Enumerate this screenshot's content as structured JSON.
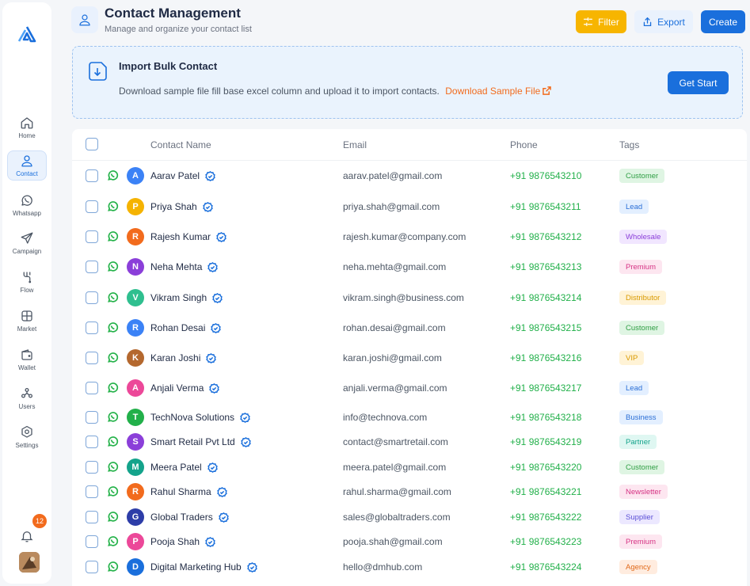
{
  "sidebar": {
    "items": [
      {
        "label": "Home",
        "icon": "home-icon",
        "active": false
      },
      {
        "label": "Contact",
        "icon": "user-icon",
        "active": true
      },
      {
        "label": "Whatsapp",
        "icon": "whatsapp-icon",
        "active": false
      },
      {
        "label": "Campaign",
        "icon": "send-icon",
        "active": false
      },
      {
        "label": "Flow",
        "icon": "flow-icon",
        "active": false
      },
      {
        "label": "Market",
        "icon": "market-icon",
        "active": false
      },
      {
        "label": "Wallet",
        "icon": "wallet-icon",
        "active": false
      },
      {
        "label": "Users",
        "icon": "users-icon",
        "active": false
      },
      {
        "label": "Settings",
        "icon": "settings-icon",
        "active": false
      }
    ],
    "notification_count": "12"
  },
  "header": {
    "title": "Contact Management",
    "subtitle": "Manage and organize your contact list",
    "filter_label": "Filter",
    "export_label": "Export",
    "create_label": "Create"
  },
  "banner": {
    "title": "Import Bulk Contact",
    "text": "Download sample file fill base excel column and upload it to import contacts.",
    "link": "Download Sample File",
    "button": "Get Start"
  },
  "table": {
    "columns": {
      "name": "Contact Name",
      "email": "Email",
      "phone": "Phone",
      "tags": "Tags"
    },
    "rows": [
      {
        "initial": "A",
        "name": "Aarav Patel",
        "email": "aarav.patel@gmail.com",
        "phone": "+91 9876543210",
        "tag": "Customer",
        "avatar_color": "#3b82f6",
        "tag_bg": "#dff5e3",
        "tag_fg": "#2f9e44"
      },
      {
        "initial": "P",
        "name": "Priya Shah",
        "email": "priya.shah@gmail.com",
        "phone": "+91 9876543211",
        "tag": "Lead",
        "avatar_color": "#f5b301",
        "tag_bg": "#e3efff",
        "tag_fg": "#2b6fd6"
      },
      {
        "initial": "R",
        "name": "Rajesh Kumar",
        "email": "rajesh.kumar@company.com",
        "phone": "+91 9876543212",
        "tag": "Wholesale",
        "avatar_color": "#f26b1d",
        "tag_bg": "#f1e6ff",
        "tag_fg": "#8b3fd9"
      },
      {
        "initial": "N",
        "name": "Neha Mehta",
        "email": "neha.mehta@gmail.com",
        "phone": "+91 9876543213",
        "tag": "Premium",
        "avatar_color": "#8b3fd9",
        "tag_bg": "#fde6f0",
        "tag_fg": "#d63384"
      },
      {
        "initial": "V",
        "name": "Vikram Singh",
        "email": "vikram.singh@business.com",
        "phone": "+91 9876543214",
        "tag": "Distributor",
        "avatar_color": "#2fbf8f",
        "tag_bg": "#fff3d6",
        "tag_fg": "#d99a00"
      },
      {
        "initial": "R",
        "name": "Rohan Desai",
        "email": "rohan.desai@gmail.com",
        "phone": "+91 9876543215",
        "tag": "Customer",
        "avatar_color": "#3b82f6",
        "tag_bg": "#dff5e3",
        "tag_fg": "#2f9e44"
      },
      {
        "initial": "K",
        "name": "Karan Joshi",
        "email": "karan.joshi@gmail.com",
        "phone": "+91 9876543216",
        "tag": "VIP",
        "avatar_color": "#b4682e",
        "tag_bg": "#fff3d6",
        "tag_fg": "#d99a00"
      },
      {
        "initial": "A",
        "name": "Anjali Verma",
        "email": "anjali.verma@gmail.com",
        "phone": "+91 9876543217",
        "tag": "Lead",
        "avatar_color": "#ec4899",
        "tag_bg": "#e3efff",
        "tag_fg": "#2b6fd6"
      },
      {
        "initial": "T",
        "name": "TechNova Solutions",
        "email": "info@technova.com",
        "phone": "+91 9876543218",
        "tag": "Business",
        "avatar_color": "#22b04a",
        "tag_bg": "#e3efff",
        "tag_fg": "#2b6fd6"
      },
      {
        "initial": "S",
        "name": "Smart Retail Pvt Ltd",
        "email": "contact@smartretail.com",
        "phone": "+91 9876543219",
        "tag": "Partner",
        "avatar_color": "#8b3fd9",
        "tag_bg": "#dff7f2",
        "tag_fg": "#14a38b"
      },
      {
        "initial": "M",
        "name": "Meera Patel",
        "email": "meera.patel@gmail.com",
        "phone": "+91 9876543220",
        "tag": "Customer",
        "avatar_color": "#14a38b",
        "tag_bg": "#dff5e3",
        "tag_fg": "#2f9e44"
      },
      {
        "initial": "R",
        "name": "Rahul Sharma",
        "email": "rahul.sharma@gmail.com",
        "phone": "+91 9876543221",
        "tag": "Newsletter",
        "avatar_color": "#f26b1d",
        "tag_bg": "#fde6f0",
        "tag_fg": "#d63384"
      },
      {
        "initial": "G",
        "name": "Global Traders",
        "email": "sales@globaltraders.com",
        "phone": "+91 9876543222",
        "tag": "Supplier",
        "avatar_color": "#2d3da8",
        "tag_bg": "#ece8ff",
        "tag_fg": "#5b4fd6"
      },
      {
        "initial": "P",
        "name": "Pooja Shah",
        "email": "pooja.shah@gmail.com",
        "phone": "+91 9876543223",
        "tag": "Premium",
        "avatar_color": "#ec4899",
        "tag_bg": "#fde6f0",
        "tag_fg": "#d63384"
      },
      {
        "initial": "D",
        "name": "Digital Marketing Hub",
        "email": "hello@dmhub.com",
        "phone": "+91 9876543224",
        "tag": "Agency",
        "avatar_color": "#1a6fdc",
        "tag_bg": "#ffecdf",
        "tag_fg": "#e06a1b"
      }
    ]
  }
}
